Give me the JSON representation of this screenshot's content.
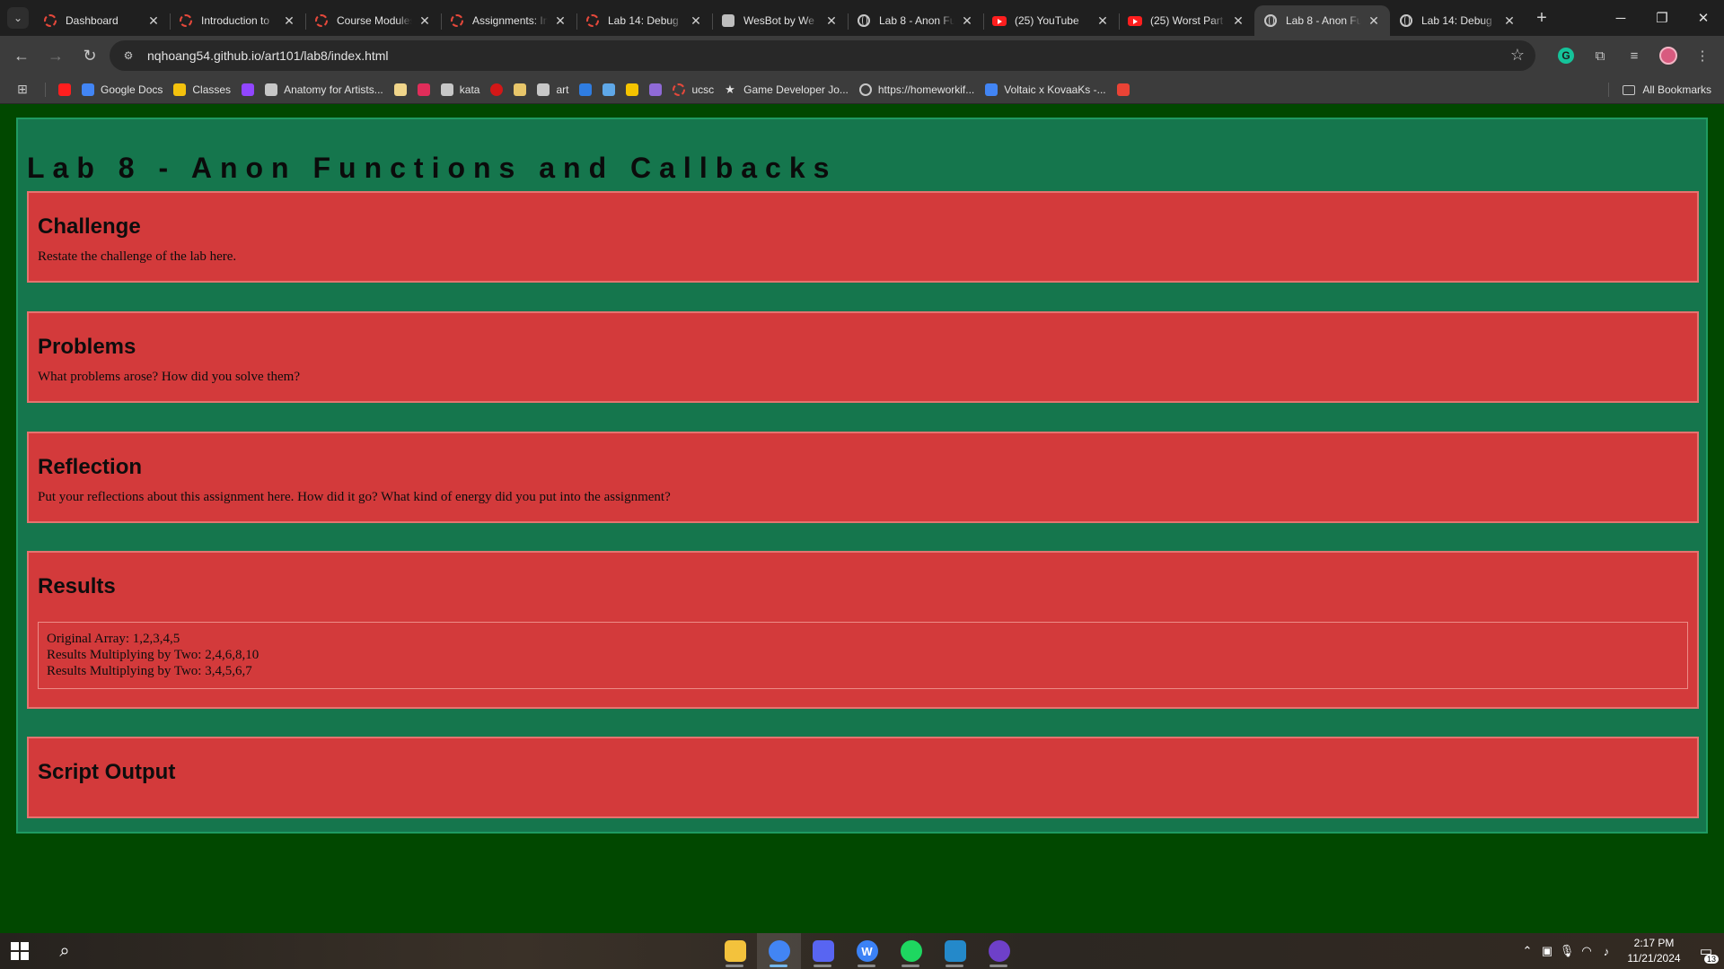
{
  "browser": {
    "tabs": [
      {
        "title": "Dashboard",
        "favicon": "canvas-ring-icon",
        "active": false
      },
      {
        "title": "Introduction to",
        "favicon": "canvas-ring-icon",
        "active": false
      },
      {
        "title": "Course Modules",
        "favicon": "canvas-ring-icon",
        "active": false
      },
      {
        "title": "Assignments: In",
        "favicon": "canvas-ring-icon",
        "active": false
      },
      {
        "title": "Lab 14: Debug",
        "favicon": "canvas-ring-icon",
        "active": false
      },
      {
        "title": "WesBot by We",
        "favicon": "wesbot-icon",
        "active": false
      },
      {
        "title": "Lab 8 - Anon Fu",
        "favicon": "globe-icon",
        "active": false
      },
      {
        "title": "(25) YouTube",
        "favicon": "youtube-icon",
        "active": false
      },
      {
        "title": "(25) Worst Part",
        "favicon": "youtube-icon",
        "active": false
      },
      {
        "title": "Lab 8 - Anon Fu",
        "favicon": "globe-icon",
        "active": true
      },
      {
        "title": "Lab 14: Debug",
        "favicon": "globe-icon",
        "active": false
      }
    ],
    "url": "nqhoang54.github.io/art101/lab8/index.html",
    "bookmarks": [
      {
        "label": "",
        "icon": "youtube-icon",
        "color": "#ff1e1e"
      },
      {
        "label": "Google Docs",
        "icon": "google-docs-icon",
        "color": "#4285f4"
      },
      {
        "label": "Classes",
        "icon": "classroom-icon",
        "color": "#f4c20d"
      },
      {
        "label": "",
        "icon": "twitch-icon",
        "color": "#9146ff"
      },
      {
        "label": "Anatomy for Artists...",
        "icon": "anatomy-icon",
        "color": "#c7c7c7"
      },
      {
        "label": "",
        "icon": "w-icon",
        "color": "#f0d58a"
      },
      {
        "label": "",
        "icon": "bookmark-red-icon",
        "color": "#e02d5a"
      },
      {
        "label": "kata",
        "icon": "kata-icon",
        "color": "#c7c7c7"
      },
      {
        "label": "",
        "icon": "red-dot-icon",
        "color": "#d31717"
      },
      {
        "label": "",
        "icon": "wolf-icon",
        "color": "#e8c66a"
      },
      {
        "label": "art",
        "icon": "art-icon",
        "color": "#c7c7c7"
      },
      {
        "label": "",
        "icon": "checkbox-icon",
        "color": "#2f7de1"
      },
      {
        "label": "",
        "icon": "bird-icon",
        "color": "#5fa8e8"
      },
      {
        "label": "",
        "icon": "dp-icon",
        "color": "#f5c400"
      },
      {
        "label": "",
        "icon": "image-icon",
        "color": "#8f6ad6"
      },
      {
        "label": "ucsc",
        "icon": "canvas-ring-icon",
        "color": "#e5483b"
      },
      {
        "label": "Game Developer Jo...",
        "icon": "star-icon",
        "color": "#e3e3e3"
      },
      {
        "label": "https://homeworkif...",
        "icon": "globe-icon",
        "color": "#c7c7c7"
      },
      {
        "label": "Voltaic x KovaaKs -...",
        "icon": "google-docs-icon",
        "color": "#4285f4"
      },
      {
        "label": "",
        "icon": "gmail-icon",
        "color": "#ea4335"
      }
    ],
    "all_bookmarks_label": "All Bookmarks"
  },
  "page": {
    "title": "Lab 8 - Anon Functions and Callbacks",
    "sections": {
      "challenge": {
        "heading": "Challenge",
        "body": "Restate the challenge of the lab here."
      },
      "problems": {
        "heading": "Problems",
        "body": "What problems arose? How did you solve them?"
      },
      "reflection": {
        "heading": "Reflection",
        "body": "Put your reflections about this assignment here. How did it go? What kind of energy did you put into the assignment?"
      },
      "results": {
        "heading": "Results",
        "lines": [
          "Original Array: 1,2,3,4,5",
          "Results Multiplying by Two: 2,4,6,8,10",
          "Results Multiplying by Two: 3,4,5,6,7"
        ]
      },
      "script_output": {
        "heading": "Script Output"
      }
    }
  },
  "colors": {
    "page_background": "#014800",
    "container": "#15764d",
    "section": "#d33a3b"
  },
  "taskbar": {
    "apps": [
      {
        "name": "file-explorer-icon",
        "glyph": "",
        "color": "#f3c23c",
        "running": true,
        "active": false
      },
      {
        "name": "chrome-icon",
        "glyph": "",
        "color": "#4285f4",
        "running": true,
        "active": true
      },
      {
        "name": "discord-icon",
        "glyph": "",
        "color": "#5865f2",
        "running": true,
        "active": false
      },
      {
        "name": "wesbot-app-icon",
        "glyph": "W",
        "color": "#3b82f6",
        "running": true,
        "active": false
      },
      {
        "name": "spotify-icon",
        "glyph": "",
        "color": "#1ed760",
        "running": true,
        "active": false
      },
      {
        "name": "vscode-icon",
        "glyph": "",
        "color": "#2489ca",
        "running": true,
        "active": false
      },
      {
        "name": "github-desktop-icon",
        "glyph": "",
        "color": "#6e40c9",
        "running": true,
        "active": false
      }
    ],
    "time": "2:17 PM",
    "date": "11/21/2024",
    "notifications": "13"
  }
}
